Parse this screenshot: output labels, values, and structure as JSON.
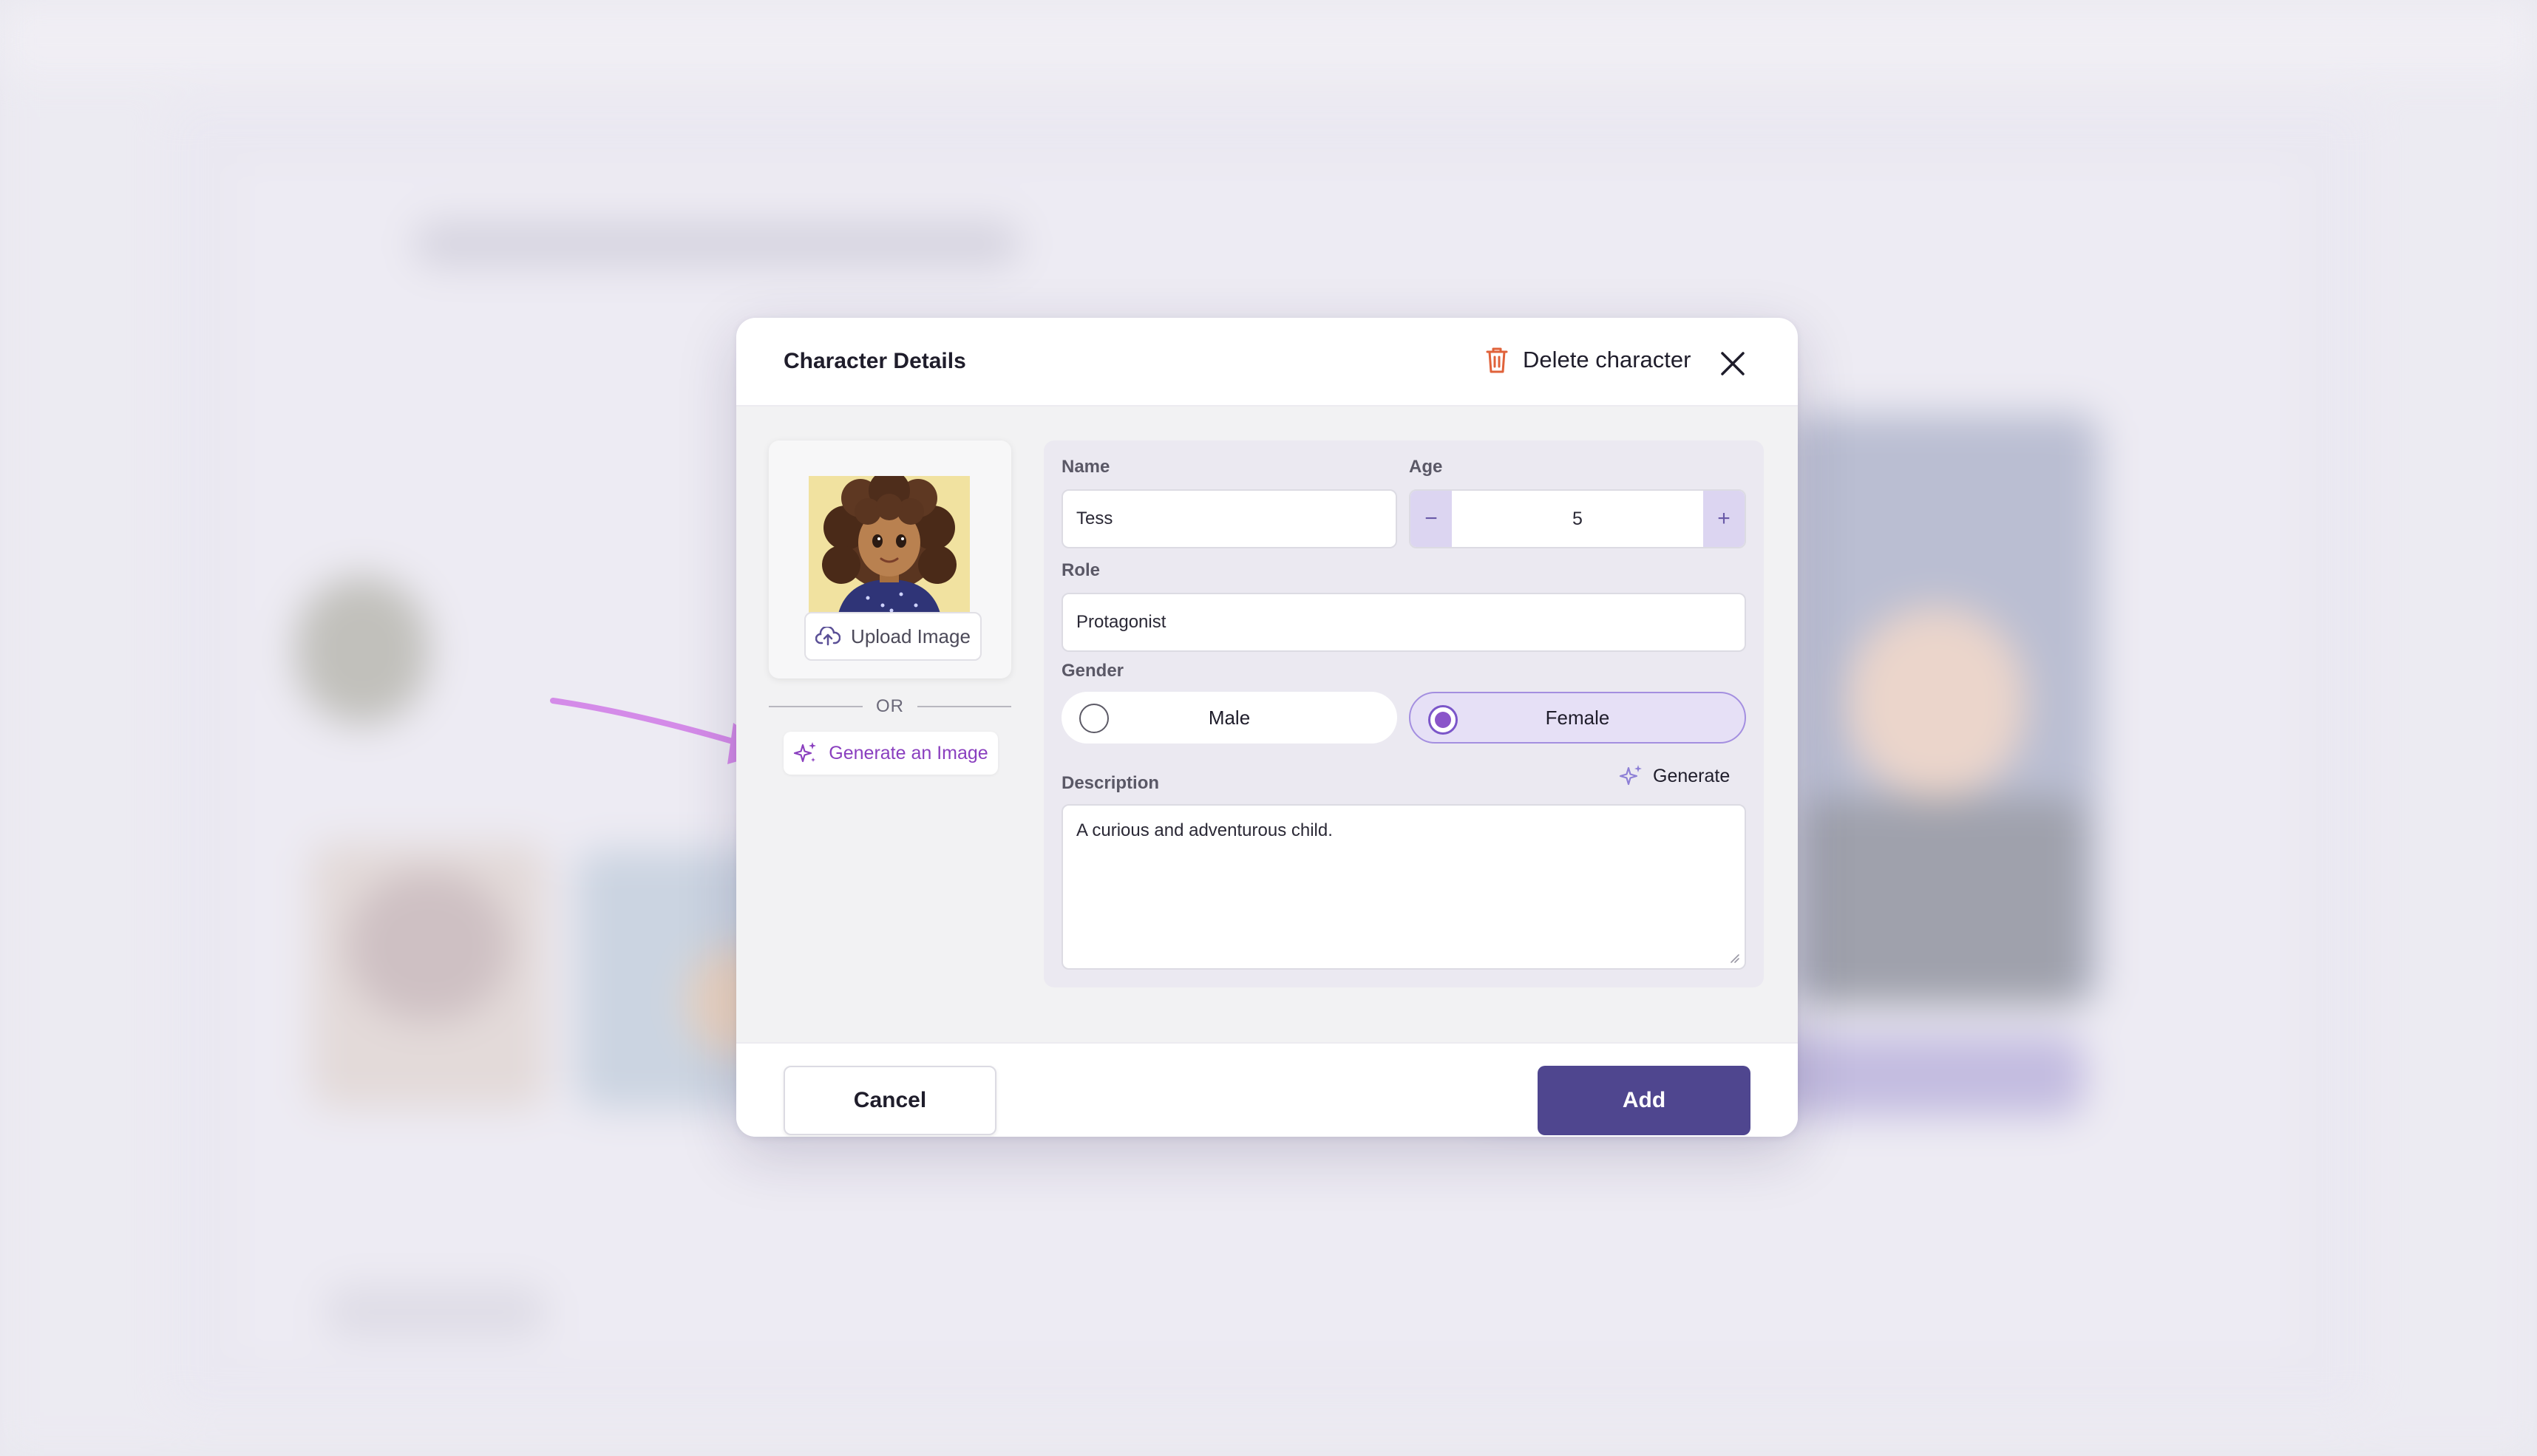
{
  "modal": {
    "title": "Character Details",
    "delete_label": "Delete character",
    "close_icon": "close-icon"
  },
  "image_panel": {
    "upload_label": "Upload Image",
    "or_label": "OR",
    "generate_image_label": "Generate an Image"
  },
  "form": {
    "name_label": "Name",
    "name_value": "Tess",
    "age_label": "Age",
    "age_value": "5",
    "age_decrement": "−",
    "age_increment": "+",
    "role_label": "Role",
    "role_value": "Protagonist",
    "gender_label": "Gender",
    "gender_options": [
      {
        "label": "Male",
        "selected": false
      },
      {
        "label": "Female",
        "selected": true
      }
    ],
    "description_label": "Description",
    "generate_label": "Generate",
    "description_value": "A curious and adventurous child."
  },
  "footer": {
    "cancel_label": "Cancel",
    "add_label": "Add"
  },
  "colors": {
    "accent": "#4f468f",
    "generate_purple": "#8a3fbf",
    "delete_orange": "#e0623a",
    "annotation_arrow": "#d48be8"
  }
}
